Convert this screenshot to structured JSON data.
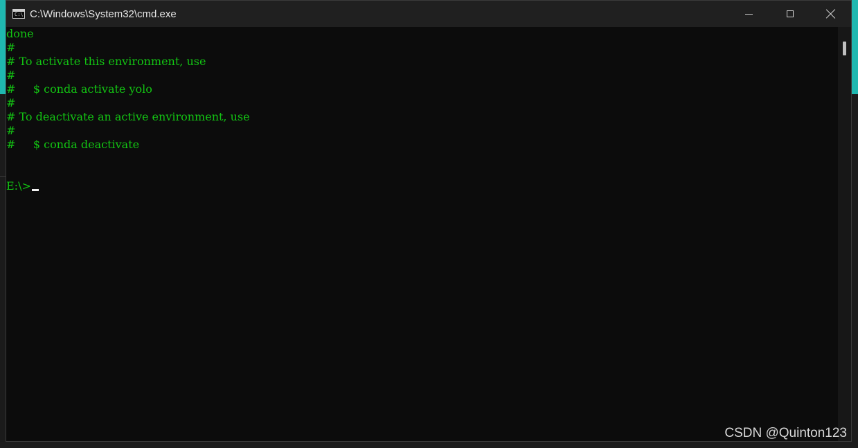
{
  "window": {
    "title": "C:\\Windows\\System32\\cmd.exe",
    "icon": "cmd-icon",
    "controls": [
      "minimize-icon",
      "maximize-icon",
      "close-icon"
    ]
  },
  "console": {
    "text_color": "#13c413",
    "lines": [
      "done",
      "#",
      "# To activate this environment, use",
      "#",
      "#     $ conda activate yolo",
      "#",
      "# To deactivate an active environment, use",
      "#",
      "#     $ conda deactivate",
      "",
      "",
      "E:\\>"
    ]
  },
  "watermark": {
    "text": "CSDN @Quinton123"
  }
}
